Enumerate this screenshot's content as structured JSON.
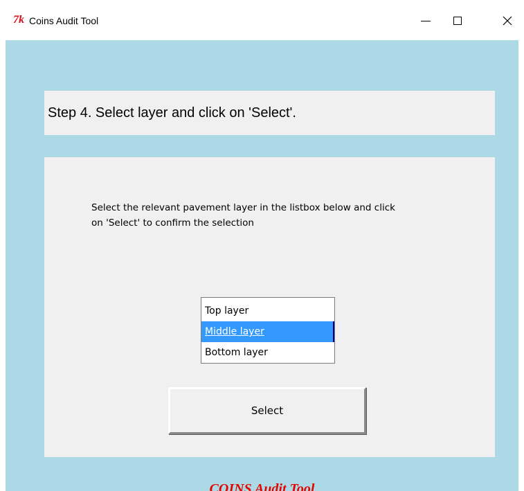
{
  "window": {
    "logo_text": "7k",
    "title": "Coins Audit Tool"
  },
  "controls": {
    "minimize_icon": "minimize-icon",
    "maximize_icon": "maximize-icon",
    "close_icon": "close-icon"
  },
  "step": {
    "text": "Step 4. Select layer and click on 'Select'."
  },
  "instructions": {
    "line1": "Select the relevant pavement layer in the listbox below and click",
    "line2": "on 'Select' to confirm the selection"
  },
  "listbox": {
    "items": [
      "Top layer",
      "Middle layer",
      "Bottom layer"
    ],
    "selected": "Middle layer"
  },
  "select_button": {
    "label": "Select"
  },
  "footer": {
    "text": "COINS Audit Tool"
  },
  "colors": {
    "background": "#add8e6",
    "panel": "#f0f0f0",
    "selection": "#3399ff",
    "footer_text": "#e10600",
    "logo": "#d4121b"
  }
}
